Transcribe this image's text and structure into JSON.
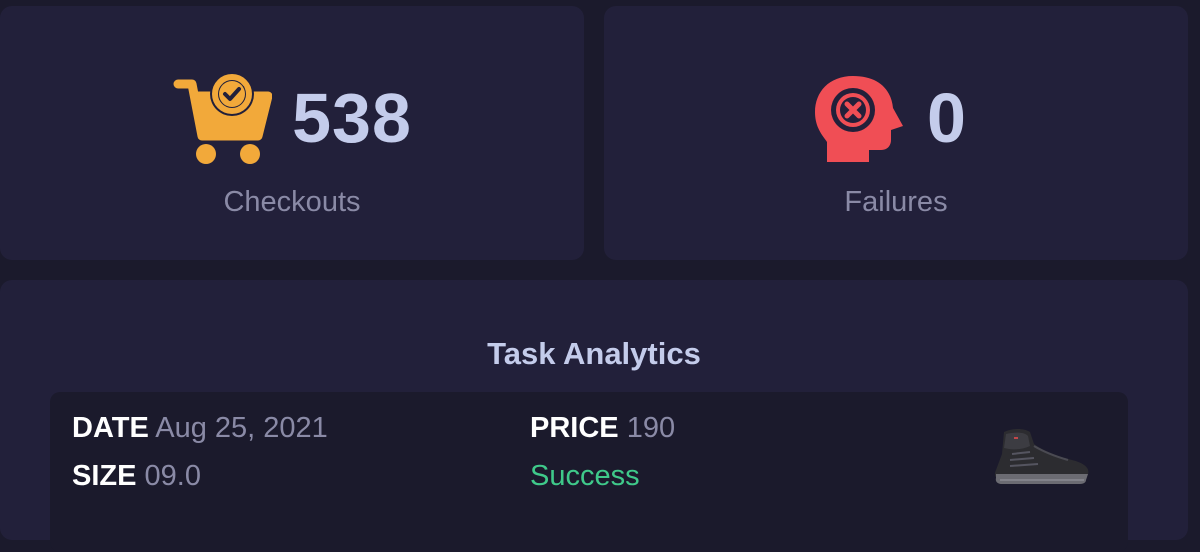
{
  "stats": {
    "checkouts": {
      "value": "538",
      "label": "Checkouts",
      "icon": "cart-check-icon",
      "color": "#f2a93a"
    },
    "failures": {
      "value": "0",
      "label": "Failures",
      "icon": "head-x-icon",
      "color": "#f04e55"
    }
  },
  "analytics": {
    "title": "Task Analytics",
    "task": {
      "date_label": "DATE",
      "date_value": "Aug 25, 2021",
      "size_label": "SIZE",
      "size_value": "09.0",
      "price_label": "PRICE",
      "price_value": "190",
      "status": "Success",
      "status_color": "#3fc98a",
      "product_image": "sneaker-image"
    }
  }
}
